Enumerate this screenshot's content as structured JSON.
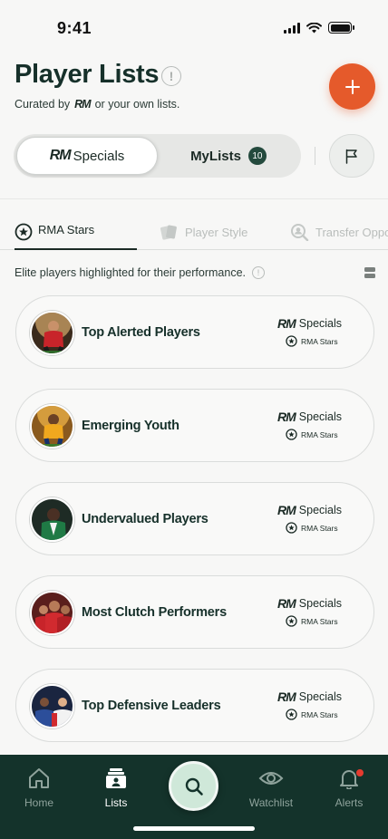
{
  "status_bar": {
    "time": "9:41"
  },
  "header": {
    "title": "Player Lists",
    "subtitle_prefix": "Curated by",
    "subtitle_logo": "RM",
    "subtitle_suffix": "or your own lists.",
    "add_icon": "plus-icon",
    "accent_color": "#e55a2b"
  },
  "segments": {
    "specials_logo": "RM",
    "specials_label": "Specials",
    "mylists_label": "MyLists",
    "mylists_count": "10",
    "flag_icon": "flag-icon"
  },
  "tabs": [
    {
      "label": "RMA Stars",
      "icon": "star-ball-icon",
      "active": true
    },
    {
      "label": "Player Style",
      "icon": "cards-icon",
      "active": false
    },
    {
      "label": "Transfer Oppor",
      "icon": "search-person-icon",
      "active": false
    }
  ],
  "description": "Elite players highlighted for their performance.",
  "cards": [
    {
      "title": "Top Alerted Players",
      "tag_logo": "RM",
      "tag_label": "Specials",
      "sub_tag": "RMA Stars"
    },
    {
      "title": "Emerging Youth",
      "tag_logo": "RM",
      "tag_label": "Specials",
      "sub_tag": "RMA Stars"
    },
    {
      "title": "Undervalued Players",
      "tag_logo": "RM",
      "tag_label": "Specials",
      "sub_tag": "RMA Stars"
    },
    {
      "title": "Most Clutch Performers",
      "tag_logo": "RM",
      "tag_label": "Specials",
      "sub_tag": "RMA Stars"
    },
    {
      "title": "Top Defensive Leaders",
      "tag_logo": "RM",
      "tag_label": "Specials",
      "sub_tag": "RMA Stars"
    }
  ],
  "nav": {
    "home": "Home",
    "lists": "Lists",
    "watchlist": "Watchlist",
    "alerts": "Alerts",
    "active": "lists",
    "bg_color": "#14332b"
  }
}
